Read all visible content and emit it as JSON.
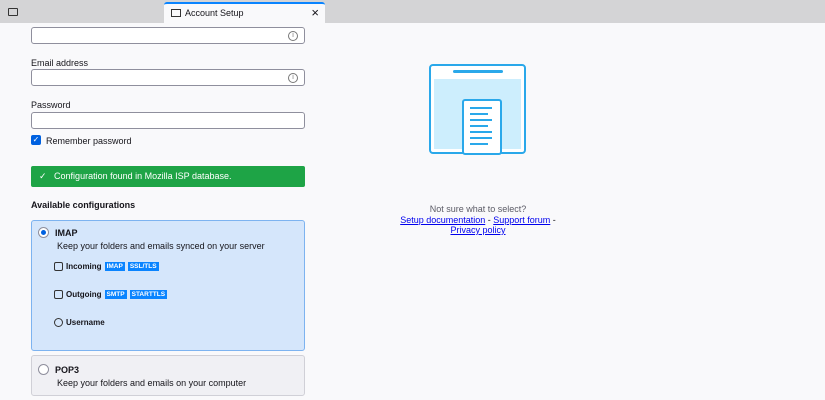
{
  "tab": {
    "title": "Account Setup"
  },
  "form": {
    "email_label": "Email address",
    "password_label": "Password",
    "remember_label": "Remember password",
    "info_glyph": "i"
  },
  "banner": "Configuration found in Mozilla ISP database.",
  "configs": {
    "heading": "Available configurations",
    "imap": {
      "title": "IMAP",
      "desc": "Keep your folders and emails synced on your server",
      "incoming": "Incoming",
      "in_badges": [
        "IMAP",
        "SSL/TLS"
      ],
      "outgoing": "Outgoing",
      "out_badges": [
        "SMTP",
        "STARTTLS"
      ],
      "username": "Username"
    },
    "pop3": {
      "title": "POP3",
      "desc": "Keep your folders and emails on your computer"
    }
  },
  "help": {
    "question": "Not sure what to select?",
    "links": [
      "Setup documentation",
      "Support forum",
      "Privacy policy"
    ],
    "sep": " - "
  }
}
